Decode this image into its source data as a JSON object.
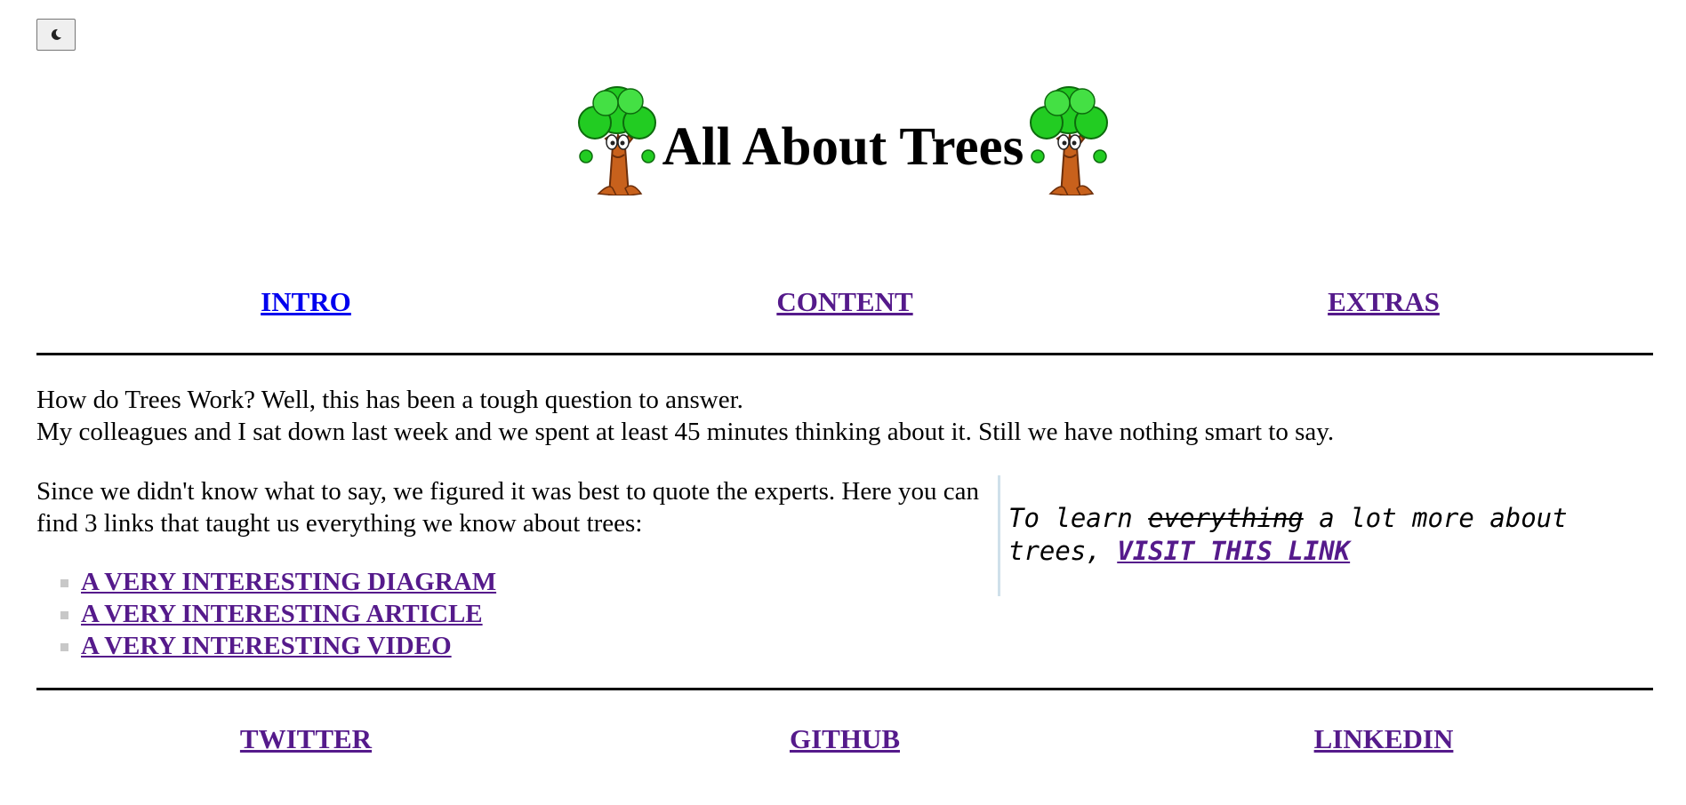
{
  "theme_toggle": {
    "icon": "moon-icon"
  },
  "header": {
    "title": "All About Trees",
    "logo_icon": "tree-mascot-icon"
  },
  "nav": [
    {
      "label": "INTRO",
      "state": "unvisited"
    },
    {
      "label": "CONTENT",
      "state": "visited"
    },
    {
      "label": "EXTRAS",
      "state": "visited"
    }
  ],
  "intro": {
    "line1": "How do Trees Work? Well, this has been a tough question to answer.",
    "line2": "My colleagues and I sat down last week and we spent at least 45 minutes thinking about it. Still we have nothing smart to say."
  },
  "content": {
    "paragraph": "Since we didn't know what to say, we figured it was best to quote the experts. Here you can find 3 links that taught us everything we know about trees:",
    "links": [
      {
        "label": "A VERY INTERESTING DIAGRAM"
      },
      {
        "label": "A VERY INTERESTING ARTICLE"
      },
      {
        "label": "A VERY INTERESTING VIDEO"
      }
    ]
  },
  "aside": {
    "prefix": "To learn",
    "struck": "everything",
    "middle": "a lot more about trees,",
    "link": "VISIT THIS LINK"
  },
  "footer": [
    {
      "label": "TWITTER"
    },
    {
      "label": "GITHUB"
    },
    {
      "label": "LINKEDIN"
    }
  ],
  "colors": {
    "link_visited": "#551a8b",
    "link_unvisited": "#0000ee",
    "tree_foliage": "#22cc22",
    "tree_trunk": "#c8611c"
  }
}
